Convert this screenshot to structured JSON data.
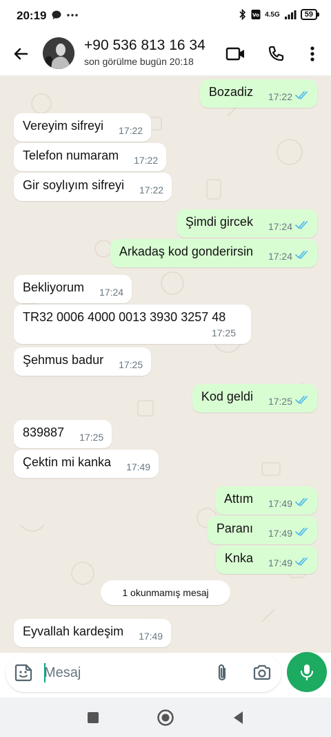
{
  "status_bar": {
    "time": "20:19",
    "network": "4.5G",
    "battery": "59"
  },
  "header": {
    "contact_name": "+90 536 813 16 34",
    "last_seen": "son görülme bugün 20:18",
    "icons": [
      "back-arrow-icon",
      "video-call-icon",
      "phone-icon",
      "more-options-icon"
    ]
  },
  "messages": [
    {
      "dir": "out",
      "text": "Bozadiz",
      "time": "17:22",
      "read": true
    },
    {
      "dir": "in",
      "text": "Vereyim sifreyi",
      "time": "17:22"
    },
    {
      "dir": "in",
      "text": "Telefon numaram",
      "time": "17:22"
    },
    {
      "dir": "in",
      "text": "Gir soylıyım sifreyi",
      "time": "17:22"
    },
    {
      "dir": "out",
      "text": "Şimdi gircek",
      "time": "17:24",
      "read": true
    },
    {
      "dir": "out",
      "text": "Arkadaş kod gonderirsin",
      "time": "17:24",
      "read": true
    },
    {
      "dir": "in",
      "text": "Bekliyorum",
      "time": "17:24"
    },
    {
      "dir": "in",
      "text": "TR32 0006 4000 0013 3930 3257 48",
      "time": "17:25"
    },
    {
      "dir": "in",
      "text": "Şehmus badur",
      "time": "17:25"
    },
    {
      "dir": "out",
      "text": "Kod geldi",
      "time": "17:25",
      "read": true
    },
    {
      "dir": "in",
      "text": "839887",
      "time": "17:25"
    },
    {
      "dir": "in",
      "text": "Çektin mi kanka",
      "time": "17:49"
    },
    {
      "dir": "out",
      "text": "Attım",
      "time": "17:49",
      "read": true
    },
    {
      "dir": "out",
      "text": "Paranı",
      "time": "17:49",
      "read": true
    },
    {
      "dir": "out",
      "text": "Knka",
      "time": "17:49",
      "read": true
    },
    {
      "dir": "in",
      "text": "Eyvallah kardeşim",
      "time": "17:49"
    }
  ],
  "unread_banner": "1 okunmamış mesaj",
  "composer": {
    "placeholder": "Mesaj"
  },
  "colors": {
    "chat_bg": "#efeae2",
    "outgoing_bubble": "#d9fdd3",
    "incoming_bubble": "#ffffff",
    "read_ticks": "#53bdeb",
    "mic_button": "#1daa61"
  }
}
